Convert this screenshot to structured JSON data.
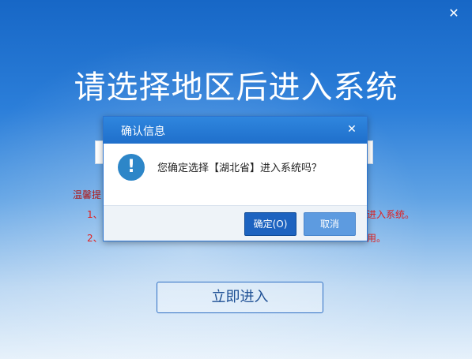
{
  "window": {
    "close_glyph": "✕"
  },
  "main": {
    "title": "请选择地区后进入系统",
    "tips_title": "温馨提",
    "tip1_prefix": "1、",
    "tip1_tail": "进入系统。",
    "tip2_prefix": "2、",
    "tip2_tail": "用。",
    "enter_button": "立即进入"
  },
  "dialog": {
    "title": "确认信息",
    "close_glyph": "✕",
    "icon": "exclamation-icon",
    "icon_glyph": "!",
    "message": "您确定选择【湖北省】进入系统吗？",
    "ok_label": "确定(O)",
    "cancel_label": "取消"
  },
  "colors": {
    "primary": "#1d63c0",
    "header": "#2f86de",
    "tip_text": "#e02020"
  }
}
